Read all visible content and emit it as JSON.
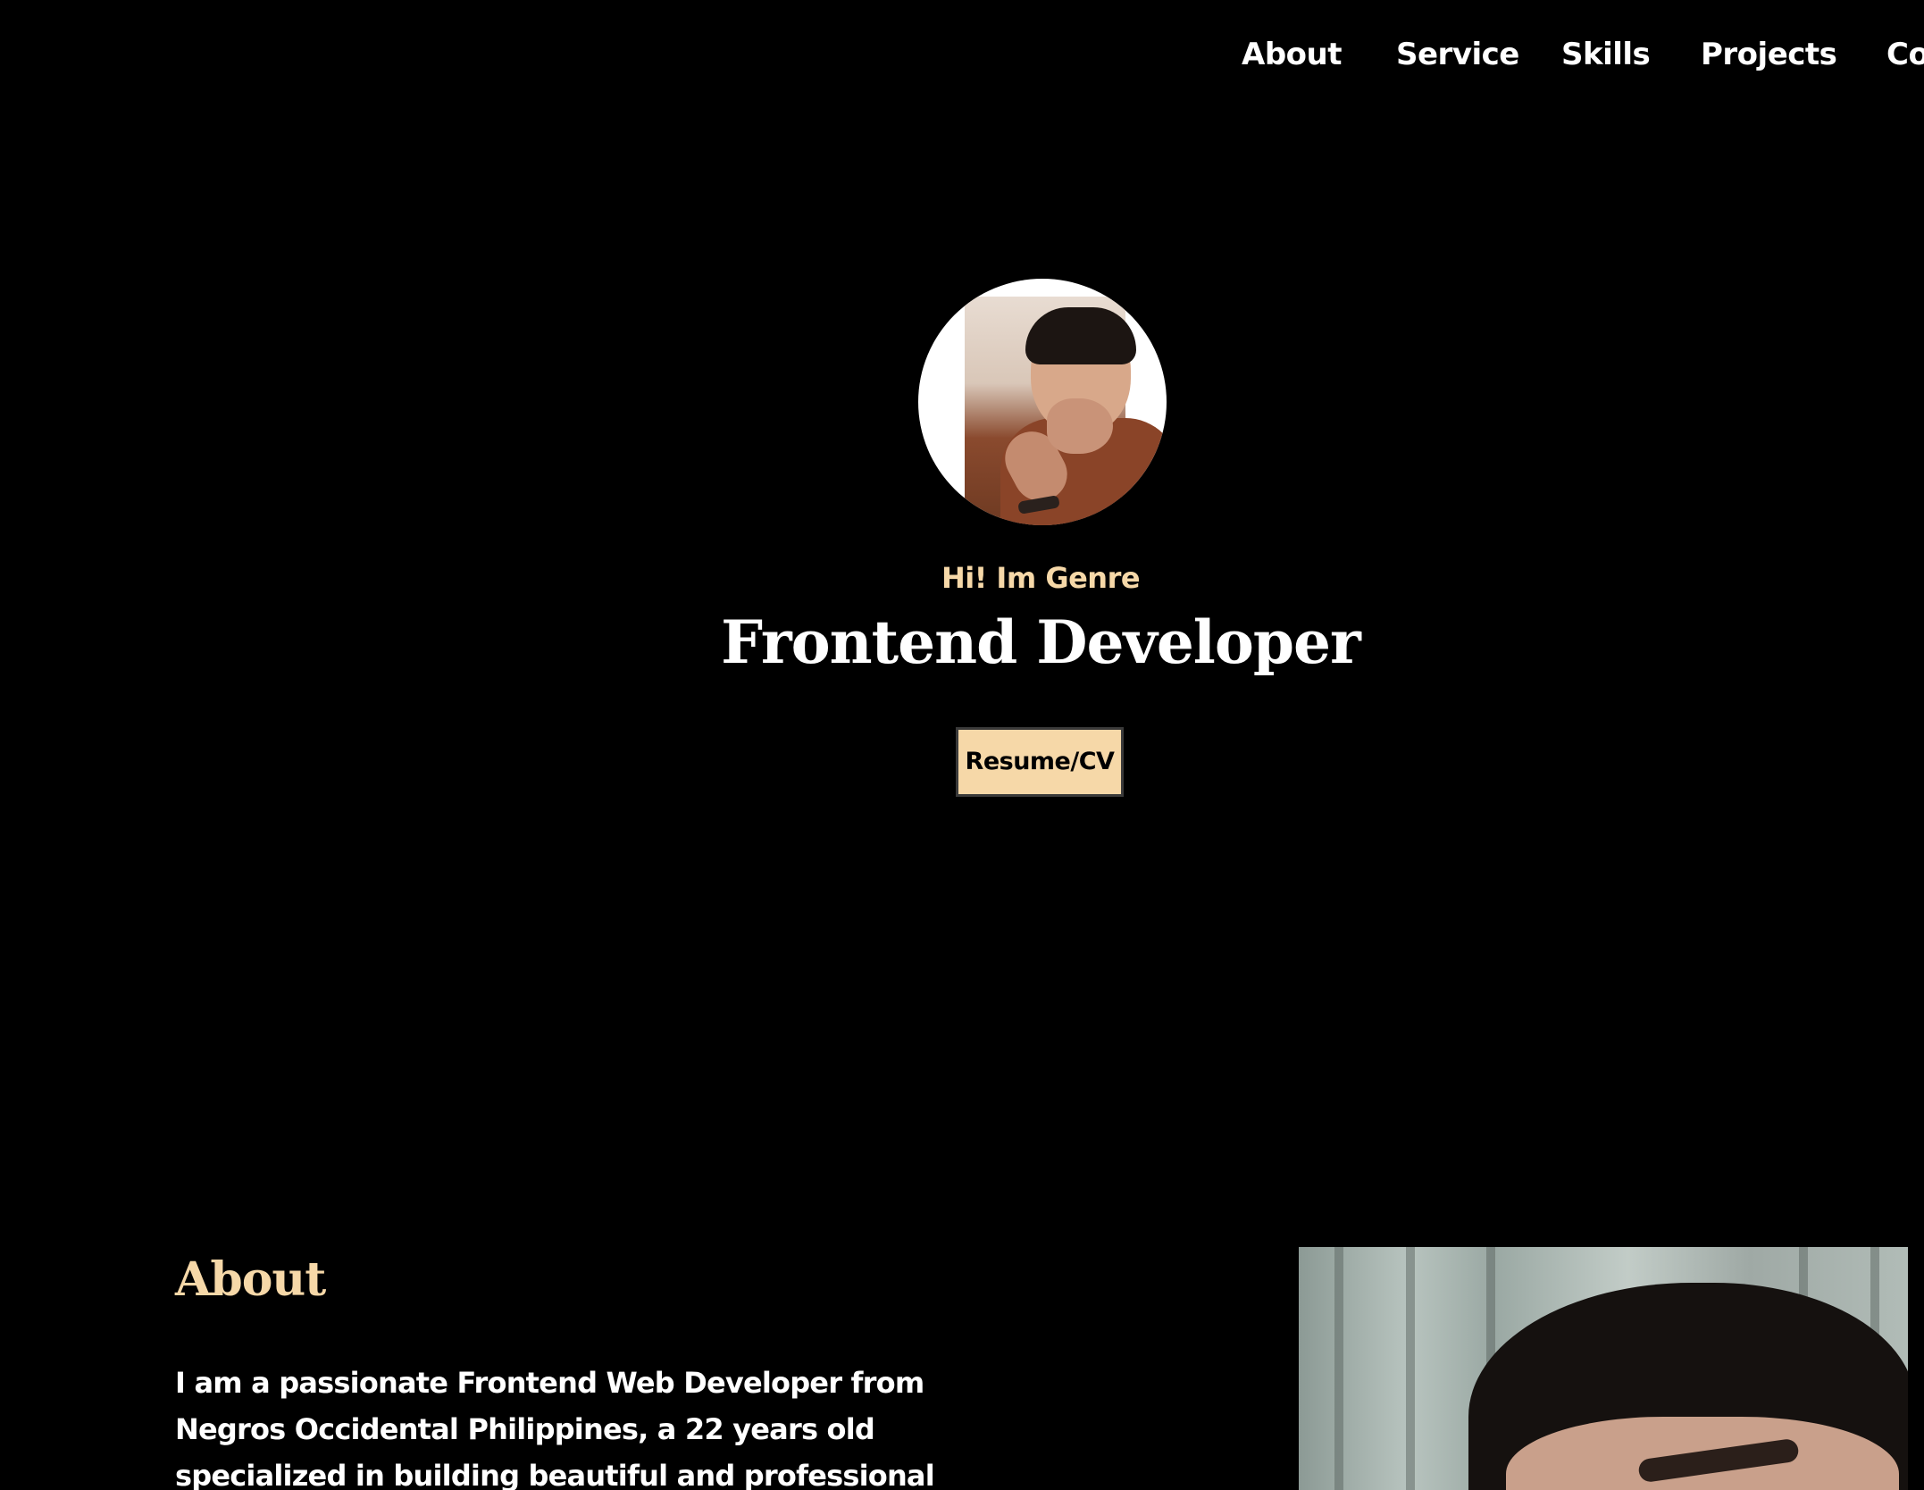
{
  "nav": {
    "items": [
      {
        "label": "About"
      },
      {
        "label": "Service"
      },
      {
        "label": "Skills"
      },
      {
        "label": "Projects"
      },
      {
        "label": "Co"
      }
    ]
  },
  "hero": {
    "greeting": "Hi! Im Genre",
    "title": "Frontend Developer",
    "resume_label": "Resume/CV"
  },
  "about": {
    "heading": "About",
    "text": "I am a passionate Frontend Web Developer from Negros Occidental Philippines, a 22 years old specialized in building beautiful and professional looking website"
  },
  "colors": {
    "background": "#000000",
    "accent": "#f6d8a8",
    "text": "#ffffff"
  }
}
